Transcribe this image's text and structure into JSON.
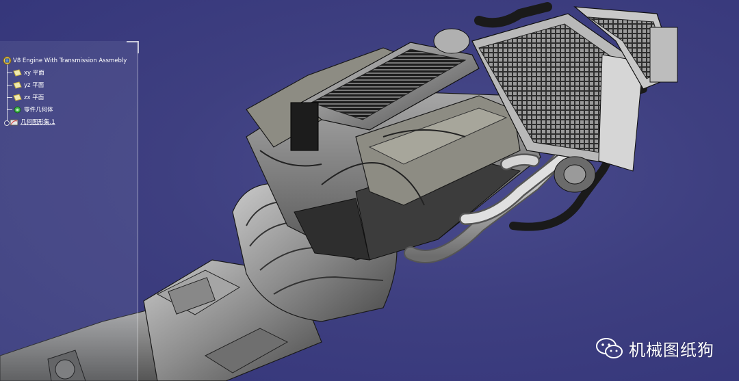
{
  "tree": {
    "root_label": "V8 Engine With Transmission Assmebly",
    "items": [
      {
        "label": "xy 平面",
        "icon": "plane-icon"
      },
      {
        "label": "yz 平面",
        "icon": "plane-icon"
      },
      {
        "label": "zx 平面",
        "icon": "plane-icon"
      },
      {
        "label": "零件几何体",
        "icon": "part-body-icon"
      },
      {
        "label": "几何图形集.1",
        "icon": "geometrical-set-icon"
      }
    ]
  },
  "watermark": {
    "text": "机械图纸狗",
    "icon": "wechat-icon"
  },
  "colors": {
    "background": "#3e3f80",
    "model_gray": "#8f8f8f",
    "tree_text": "#ffffff"
  }
}
